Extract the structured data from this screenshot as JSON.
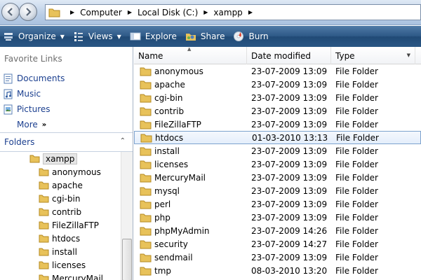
{
  "address": {
    "crumbs": [
      "Computer",
      "Local Disk (C:)",
      "xampp"
    ]
  },
  "toolbar": {
    "organize": "Organize",
    "views": "Views",
    "explore": "Explore",
    "share": "Share",
    "burn": "Burn"
  },
  "navpane": {
    "favorites_header": "Favorite Links",
    "favorites": [
      {
        "label": "Documents",
        "icon": "documents-icon"
      },
      {
        "label": "Music",
        "icon": "music-icon"
      },
      {
        "label": "Pictures",
        "icon": "pictures-icon"
      }
    ],
    "more_label": "More",
    "folders_header": "Folders",
    "tree_root": "xampp",
    "tree_children": [
      "anonymous",
      "apache",
      "cgi-bin",
      "contrib",
      "FileZillaFTP",
      "htdocs",
      "install",
      "licenses",
      "MercuryMail"
    ]
  },
  "filelist": {
    "columns": {
      "name": "Name",
      "date": "Date modified",
      "type": "Type"
    },
    "rows": [
      {
        "name": "anonymous",
        "date": "23-07-2009 13:09",
        "type": "File Folder"
      },
      {
        "name": "apache",
        "date": "23-07-2009 13:09",
        "type": "File Folder"
      },
      {
        "name": "cgi-bin",
        "date": "23-07-2009 13:09",
        "type": "File Folder"
      },
      {
        "name": "contrib",
        "date": "23-07-2009 13:09",
        "type": "File Folder"
      },
      {
        "name": "FileZillaFTP",
        "date": "23-07-2009 13:09",
        "type": "File Folder"
      },
      {
        "name": "htdocs",
        "date": "01-03-2010 13:13",
        "type": "File Folder",
        "selected": true
      },
      {
        "name": "install",
        "date": "23-07-2009 13:09",
        "type": "File Folder"
      },
      {
        "name": "licenses",
        "date": "23-07-2009 13:09",
        "type": "File Folder"
      },
      {
        "name": "MercuryMail",
        "date": "23-07-2009 13:09",
        "type": "File Folder"
      },
      {
        "name": "mysql",
        "date": "23-07-2009 13:09",
        "type": "File Folder"
      },
      {
        "name": "perl",
        "date": "23-07-2009 13:09",
        "type": "File Folder"
      },
      {
        "name": "php",
        "date": "23-07-2009 13:09",
        "type": "File Folder"
      },
      {
        "name": "phpMyAdmin",
        "date": "23-07-2009 14:26",
        "type": "File Folder"
      },
      {
        "name": "security",
        "date": "23-07-2009 14:27",
        "type": "File Folder"
      },
      {
        "name": "sendmail",
        "date": "23-07-2009 13:09",
        "type": "File Folder"
      },
      {
        "name": "tmp",
        "date": "08-03-2010 13:20",
        "type": "File Folder"
      }
    ]
  },
  "colors": {
    "folder": "#e8c25a",
    "link": "#1b3f8f",
    "toolbar": "#2d5886",
    "selection_border": "#7da2ce"
  }
}
